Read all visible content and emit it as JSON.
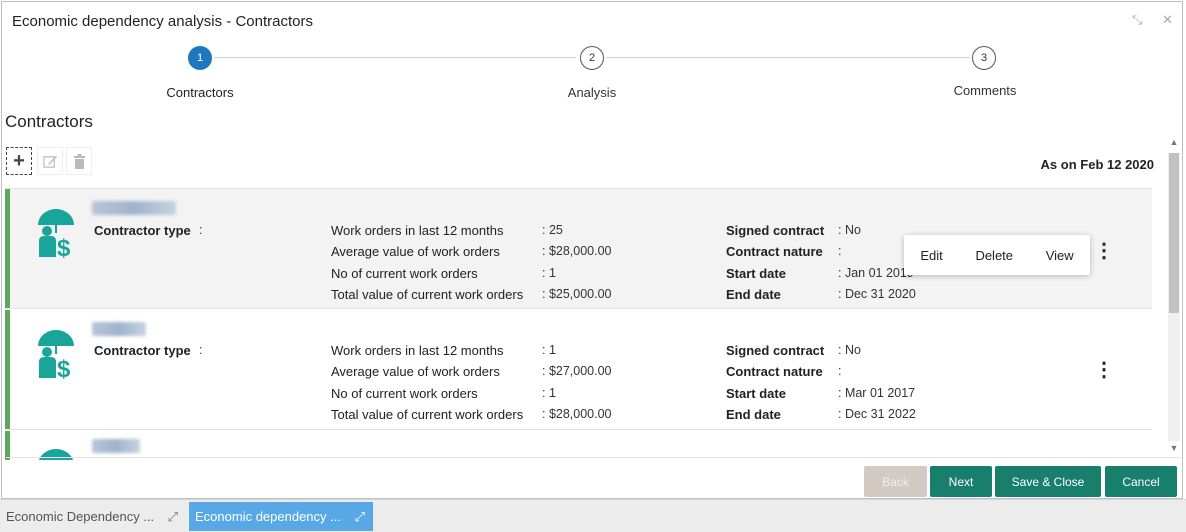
{
  "window": {
    "title": "Economic dependency analysis - Contractors"
  },
  "stepper": {
    "steps": [
      {
        "number": "1",
        "label": "Contractors",
        "active": true
      },
      {
        "number": "2",
        "label": "Analysis",
        "active": false
      },
      {
        "number": "3",
        "label": "Comments",
        "active": false
      }
    ]
  },
  "section": {
    "title": "Contractors",
    "as_on": "As on Feb 12 2020"
  },
  "toolbar": {
    "add_icon": "plus-icon",
    "edit_icon": "edit-icon",
    "delete_icon": "trash-icon"
  },
  "cards": [
    {
      "contractor_type_label": "Contractor type",
      "contractor_type_sep": ":",
      "metrics": [
        {
          "label": "Work orders in last 12 months",
          "value": ": 25"
        },
        {
          "label": "Average value of work orders",
          "value": ": $28,000.00"
        },
        {
          "label": "No of current work orders",
          "value": ": 1"
        },
        {
          "label": "Total value of current work orders",
          "value": ": $25,000.00"
        }
      ],
      "contract": [
        {
          "label": "Signed contract",
          "value": ": No"
        },
        {
          "label": "Contract nature",
          "value": ":"
        },
        {
          "label": "Start date",
          "value": ": Jan 01 2019"
        },
        {
          "label": "End date",
          "value": ": Dec 31 2020"
        }
      ]
    },
    {
      "contractor_type_label": "Contractor type",
      "contractor_type_sep": ":",
      "metrics": [
        {
          "label": "Work orders in last 12 months",
          "value": ": 1"
        },
        {
          "label": "Average value of work orders",
          "value": ": $27,000.00"
        },
        {
          "label": "No of current work orders",
          "value": ": 1"
        },
        {
          "label": "Total value of current work orders",
          "value": ": $28,000.00"
        }
      ],
      "contract": [
        {
          "label": "Signed contract",
          "value": ": No"
        },
        {
          "label": "Contract nature",
          "value": ":"
        },
        {
          "label": "Start date",
          "value": ": Mar 01 2017"
        },
        {
          "label": "End date",
          "value": ": Dec 31 2022"
        }
      ]
    }
  ],
  "context_menu": {
    "edit": "Edit",
    "delete": "Delete",
    "view": "View"
  },
  "footer": {
    "back": "Back",
    "next": "Next",
    "save_close": "Save & Close",
    "cancel": "Cancel"
  },
  "taskbar": [
    {
      "label": "Economic Dependency ...",
      "active": false
    },
    {
      "label": "Economic dependency ...",
      "active": true
    }
  ],
  "colors": {
    "accent": "#1f77c0",
    "primary_button": "#177f6c",
    "card_bar": "#5aa95a",
    "active_task": "#59a8e6"
  }
}
